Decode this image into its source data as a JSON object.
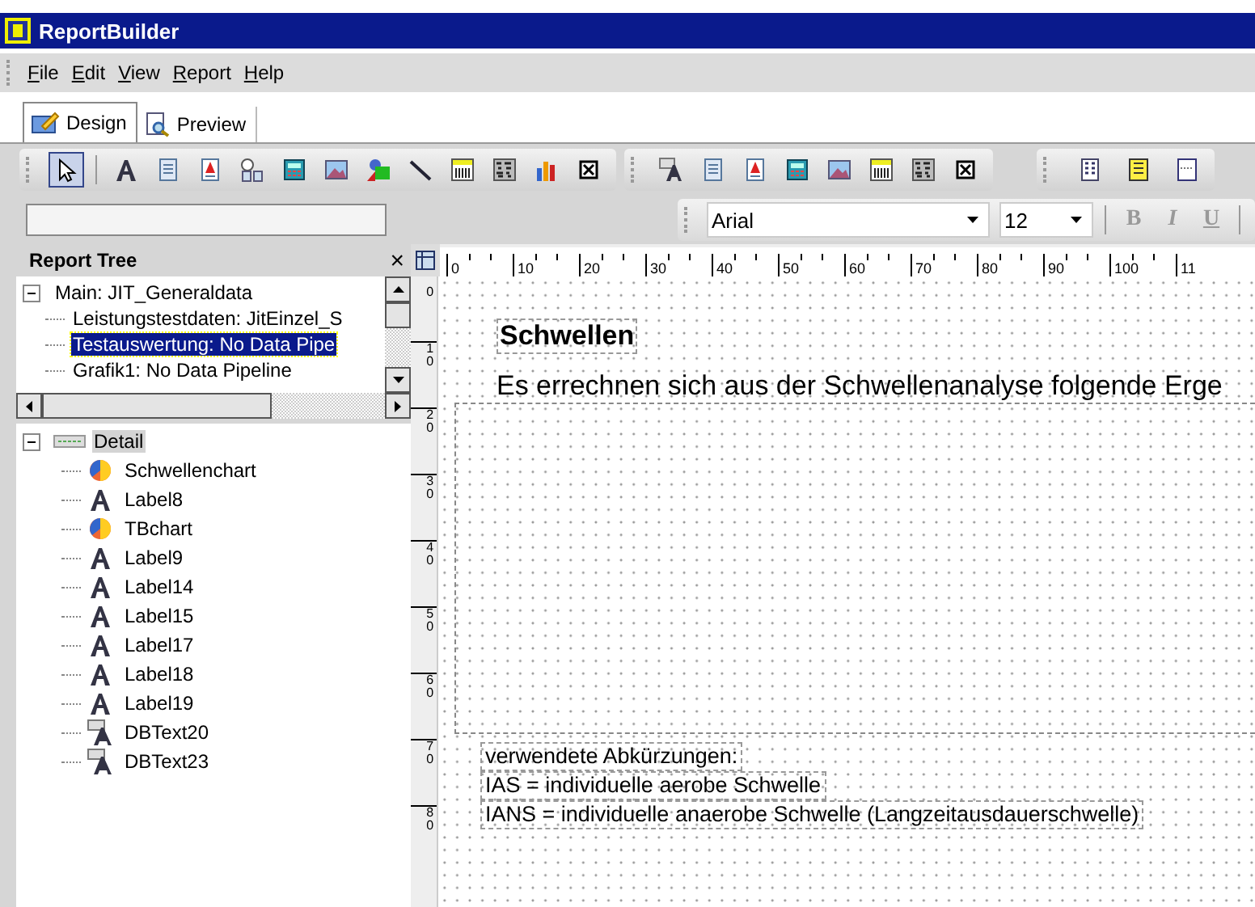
{
  "window": {
    "title": "ReportBuilder"
  },
  "menu": [
    "File",
    "Edit",
    "View",
    "Report",
    "Help"
  ],
  "tabs": [
    {
      "label": "Design",
      "selected": true
    },
    {
      "label": "Preview",
      "selected": false
    }
  ],
  "component_tools": [
    {
      "selected": true
    },
    {
      "selected": false
    },
    {
      "selected": false
    },
    {
      "selected": false
    },
    {
      "selected": false
    },
    {
      "selected": false
    },
    {
      "selected": false
    },
    {
      "selected": false
    },
    {
      "selected": false
    },
    {
      "selected": false
    },
    {
      "selected": false
    },
    {
      "selected": false
    },
    {
      "selected": false
    }
  ],
  "format_toolbar": {
    "font": "Arial",
    "size": "12",
    "buttons": [
      {
        "label": "B",
        "disabled": true
      },
      {
        "label": "I",
        "disabled": true
      },
      {
        "label": "U",
        "disabled": true
      }
    ]
  },
  "report_tree": {
    "title": "Report Tree",
    "close": "×",
    "upper": [
      {
        "label": "Main: JIT_Generaldata",
        "expanded": true,
        "selected": false,
        "children": [
          {
            "label": "Leistungstestdaten: JitEinzel_S",
            "selected": false
          },
          {
            "label": "Testauswertung: No Data Pipe",
            "selected": true
          },
          {
            "label": "Grafik1: No Data Pipeline",
            "selected": false
          }
        ]
      }
    ],
    "lower": [
      {
        "label": "Detail",
        "expanded": true,
        "selected": true,
        "children": [
          {
            "kind": "chart",
            "label": "Schwellenchart"
          },
          {
            "kind": "label",
            "label": "Label8"
          },
          {
            "kind": "chart",
            "label": "TBchart"
          },
          {
            "kind": "label",
            "label": "Label9"
          },
          {
            "kind": "label",
            "label": "Label14"
          },
          {
            "kind": "label",
            "label": "Label15"
          },
          {
            "kind": "label",
            "label": "Label17"
          },
          {
            "kind": "label",
            "label": "Label18"
          },
          {
            "kind": "label",
            "label": "Label19"
          },
          {
            "kind": "dbtext",
            "label": "DBText20"
          },
          {
            "kind": "dbtext",
            "label": "DBText23"
          }
        ]
      }
    ]
  },
  "ruler": {
    "horizontal": [
      "0",
      "10",
      "20",
      "30",
      "40",
      "50",
      "60",
      "70",
      "80",
      "90",
      "100",
      "11"
    ],
    "vertical": [
      "0",
      "10",
      "20",
      "30",
      "40",
      "50",
      "60",
      "70",
      "80"
    ]
  },
  "report": {
    "title": "Schwellen",
    "intro": "Es errechnen sich aus der Schwellenanalyse folgende Erge",
    "notes": [
      "verwendete Abkürzungen:",
      "IAS = individuelle aerobe Schwelle",
      "IANS = individuelle anaerobe Schwelle (Langzeitausdauerschwelle)"
    ]
  }
}
